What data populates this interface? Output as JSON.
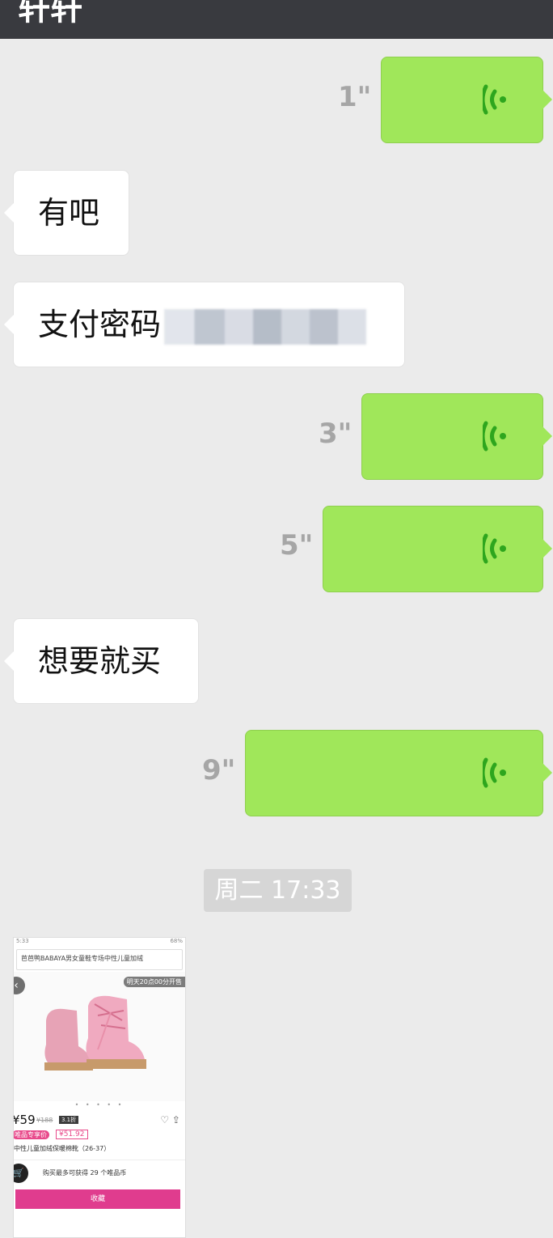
{
  "header": {
    "title": "轩轩"
  },
  "messages": {
    "voice_1": {
      "duration": "1\""
    },
    "text_1": {
      "text": "有吧"
    },
    "text_2": {
      "text": "支付密码"
    },
    "voice_2": {
      "duration": "3\""
    },
    "voice_3": {
      "duration": "5\""
    },
    "text_3": {
      "text": "想要就买"
    },
    "voice_4": {
      "duration": "9\""
    },
    "timestamp": "周二 17:33"
  },
  "shared_image": {
    "status_left": "5:33",
    "status_right": "68%",
    "search_text": "芭芭鸭BABAYA男女童鞋专场中性儿童加绒",
    "sale_badge": "明天20点00分开售",
    "dots": "• • • • •",
    "price": "¥59",
    "original_price": "¥188",
    "discount": "3.1折",
    "member_tag": "唯品专享价",
    "member_price": "¥51.92",
    "product_name": "中性儿童加绒保暖棉靴（26-37）",
    "coins_text": "购买最多可获得 29 个唯品币",
    "collect_label": "收藏"
  },
  "colors": {
    "voice_bubble": "#a0e75a",
    "wave": "#2ea61e",
    "header_bg": "#393a3f",
    "chat_bg": "#ebebeb"
  }
}
